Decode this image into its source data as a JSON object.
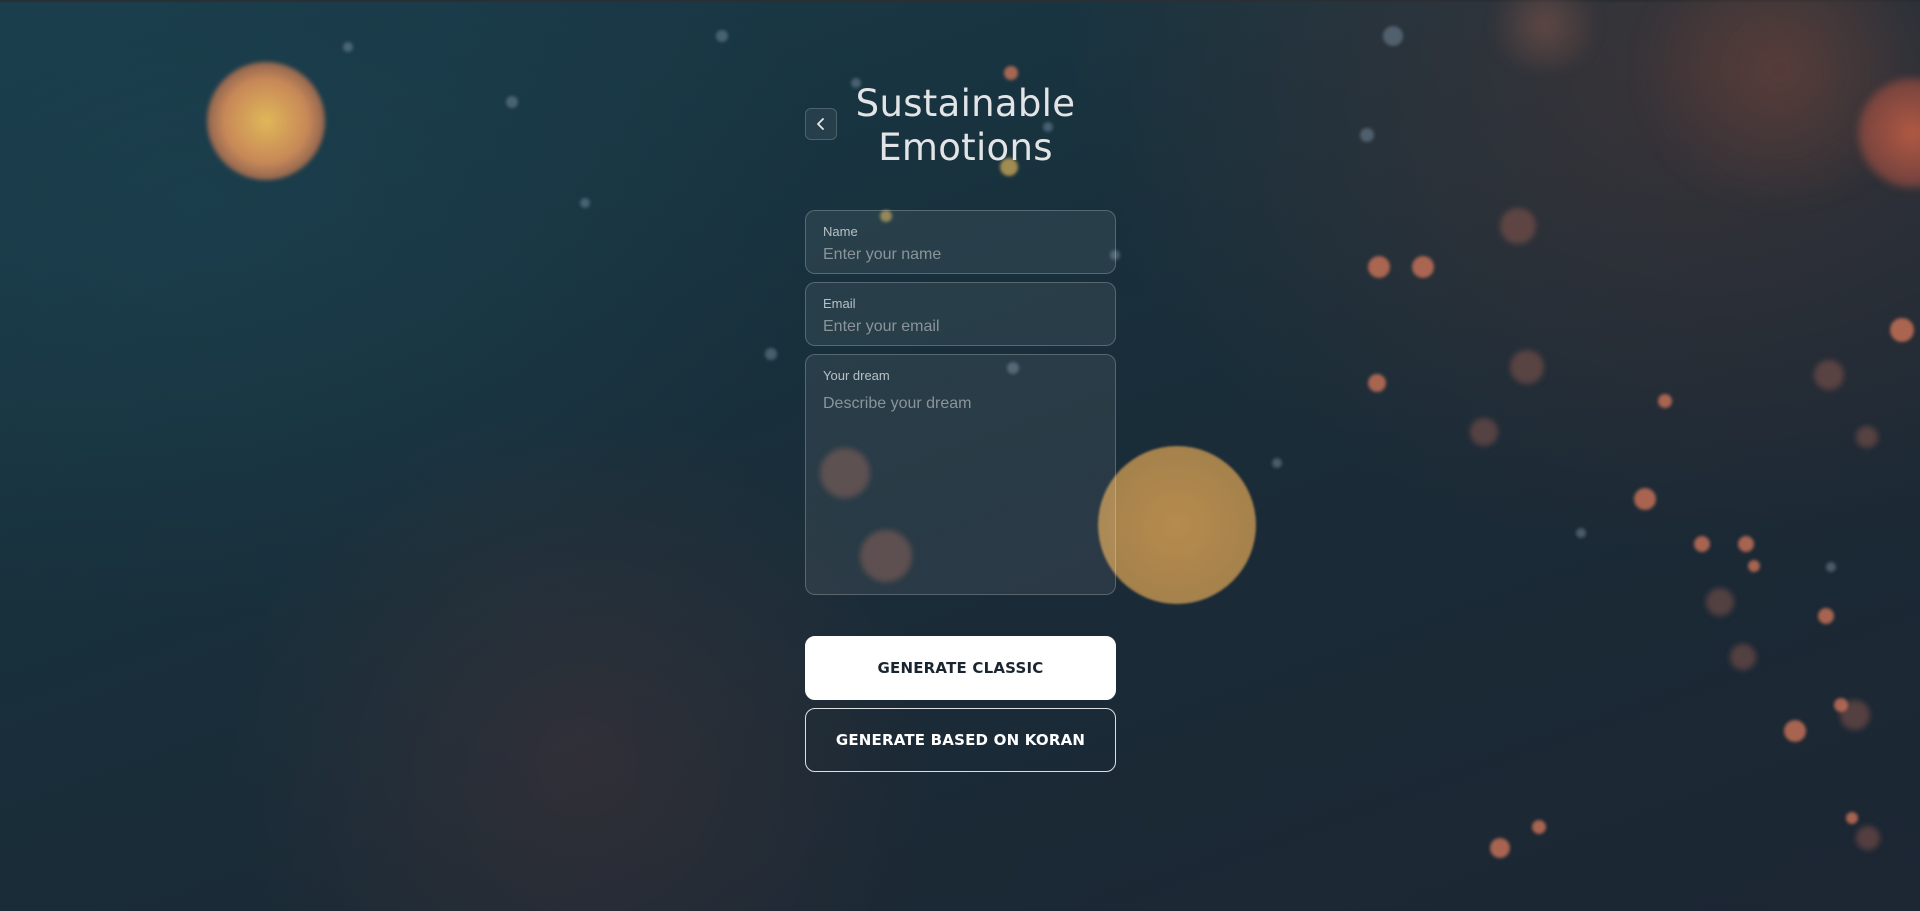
{
  "app": {
    "title_line_1": "Sustainable",
    "title_line_2": "Emotions"
  },
  "header": {
    "back_icon": "chevron-left-icon"
  },
  "form": {
    "name": {
      "label": "Name",
      "placeholder": "Enter your name",
      "value": ""
    },
    "email": {
      "label": "Email",
      "placeholder": "Enter your email",
      "value": ""
    },
    "dream": {
      "label": "Your dream",
      "placeholder": "Describe your dream",
      "value": ""
    }
  },
  "actions": {
    "generate_classic": "GENERATE CLASSIC",
    "generate_koran": "GENERATE BASED ON KORAN"
  },
  "theme": {
    "background": "#1a3340",
    "primary_button_bg": "#ffffff",
    "primary_button_text": "#1b2530",
    "text": "#e2e4e6",
    "bokeh_warm": "#e0a060"
  }
}
